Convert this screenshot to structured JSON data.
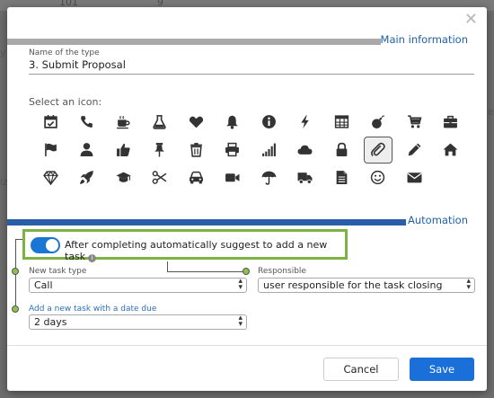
{
  "background": {
    "top_items": [
      "101",
      "9"
    ],
    "side_left": [
      "y",
      "iz"
    ],
    "side_right": [
      "e"
    ]
  },
  "dialog": {
    "close_label": "✕",
    "main_section_title": "Main information",
    "name_field": {
      "label": "Name of the type",
      "value": "3. Submit Proposal"
    },
    "icons_label": "Select an icon:",
    "icons": [
      "calendar-check-icon",
      "phone-icon",
      "coffee-icon",
      "flask-icon",
      "heart-icon",
      "bell-icon",
      "info-circle-icon",
      "bolt-icon",
      "table-icon",
      "bomb-icon",
      "cart-icon",
      "briefcase-icon",
      "flag-icon",
      "user-icon",
      "thumbs-up-icon",
      "pin-icon",
      "trash-icon",
      "printer-icon",
      "signal-icon",
      "cloud-icon",
      "lock-icon",
      "paperclip-icon",
      "pencil-icon",
      "home-icon",
      "diamond-icon",
      "rocket-icon",
      "graduation-cap-icon",
      "scissors-icon",
      "car-icon",
      "video-camera-icon",
      "umbrella-icon",
      "truck-icon",
      "document-icon",
      "smile-icon",
      "envelope-icon"
    ],
    "selected_icon": "paperclip-icon",
    "automation_section_title": "Automation",
    "toggle_label": "After completing automatically suggest to add a new task",
    "new_task_type": {
      "label": "New task type",
      "value": "Call"
    },
    "responsible": {
      "label": "Responsible",
      "value": "user responsible for the task closing"
    },
    "due_date": {
      "label": "Add a new task with a date due",
      "value": "2 days"
    },
    "cancel_label": "Cancel",
    "save_label": "Save"
  },
  "colors": {
    "accent": "#1a6fd9",
    "highlight_frame": "#7cb342",
    "section_bar_main": "#a9a9a9",
    "section_bar_automation": "#2a5ea8"
  }
}
